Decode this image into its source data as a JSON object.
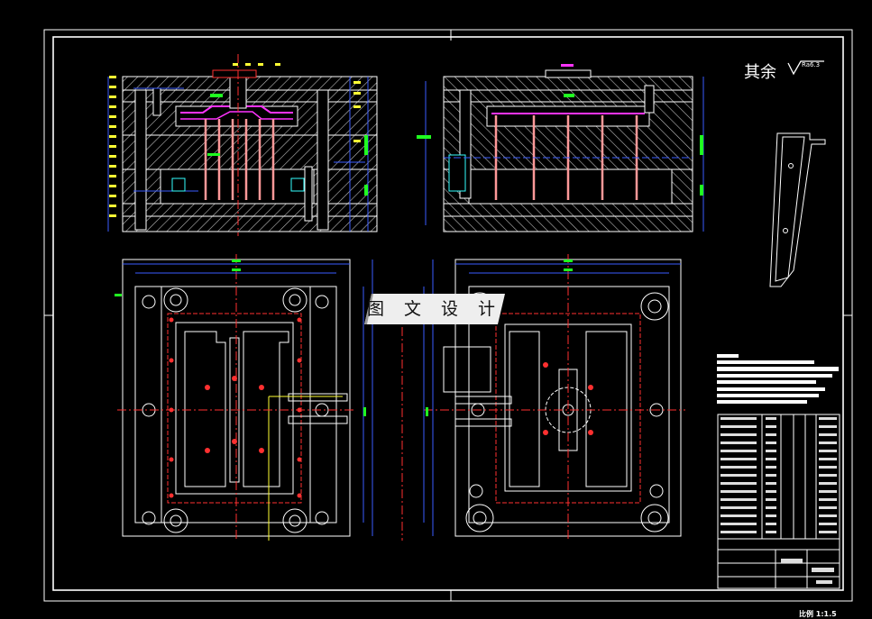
{
  "watermark": "图 文 设 计",
  "roughness": {
    "label": "其余",
    "value": "Ra6.3"
  },
  "scale_note": "比例 1:1.5",
  "colors": {
    "background": "#000000",
    "line": "#ffffff",
    "center": "#ff3030",
    "dim": "#3a5cff",
    "green": "#20ff20",
    "magenta": "#ff33ff",
    "yellow": "#ffff33",
    "cyan": "#33ffff",
    "pink": "#ff9999"
  }
}
